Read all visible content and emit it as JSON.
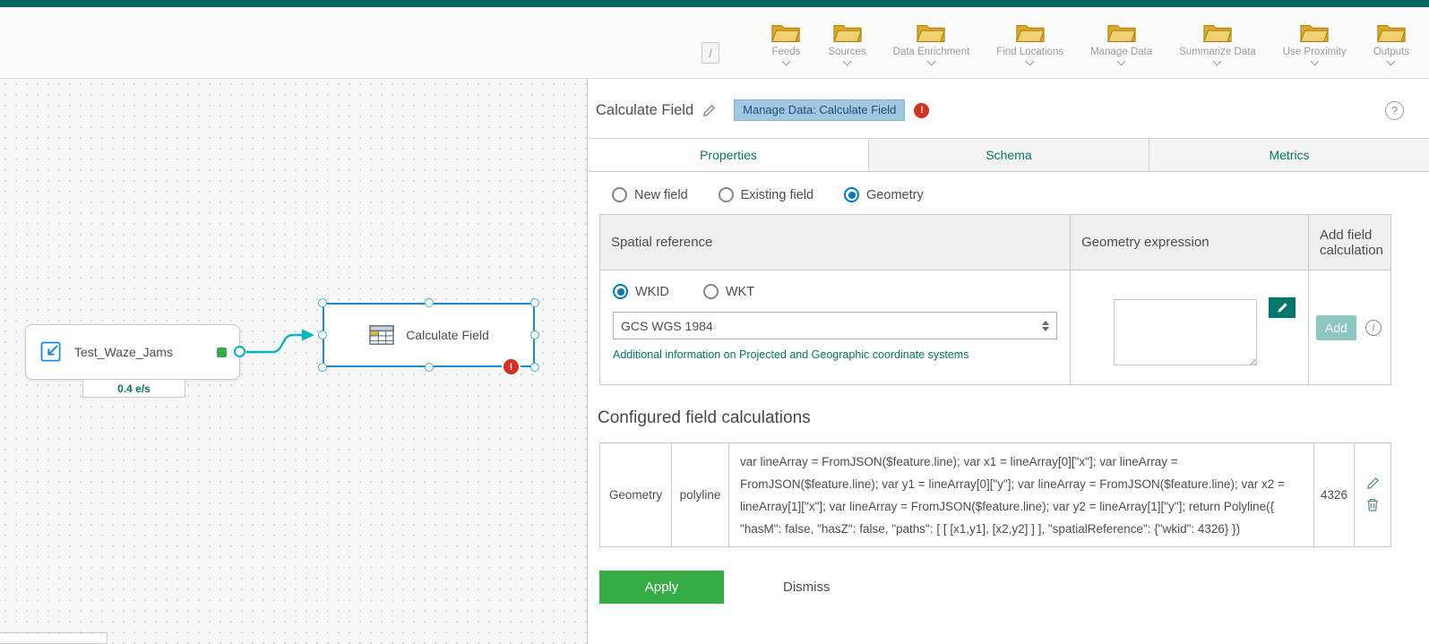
{
  "glyphs": {
    "slash": "/",
    "error": "!",
    "help": "?",
    "info": "i"
  },
  "colors": {
    "topbar": "#00665e",
    "accent_teal": "#00766c",
    "selection_blue": "#0079c1",
    "node_border_blue": "#1e88d2",
    "connection_teal": "#00b5bd",
    "error_red": "#d83020",
    "apply_green": "#35ac46",
    "badge_blue_bg": "#a2c7e0"
  },
  "toolbar": {
    "items": [
      {
        "label": "Feeds"
      },
      {
        "label": "Sources"
      },
      {
        "label": "Data Enrichment"
      },
      {
        "label": "Find Locations"
      },
      {
        "label": "Manage Data"
      },
      {
        "label": "Summarize Data"
      },
      {
        "label": "Use Proximity"
      },
      {
        "label": "Outputs"
      }
    ]
  },
  "canvas": {
    "source_node": {
      "label": "Test_Waze_Jams",
      "rate": "0.4 e/s"
    },
    "selected_node": {
      "label": "Calculate Field"
    }
  },
  "panel": {
    "title": "Calculate Field",
    "badge": "Manage Data: Calculate Field",
    "tabs": [
      {
        "label": "Properties",
        "active": true
      },
      {
        "label": "Schema",
        "active": false
      },
      {
        "label": "Metrics",
        "active": false
      }
    ],
    "field_type_options": [
      {
        "label": "New field",
        "selected": false
      },
      {
        "label": "Existing field",
        "selected": false
      },
      {
        "label": "Geometry",
        "selected": true
      }
    ],
    "geometry_config": {
      "headers": [
        "Spatial reference",
        "Geometry expression",
        "Add field calculation"
      ],
      "wkid_label": "WKID",
      "wkt_label": "WKT",
      "wkid_selected": true,
      "spatial_reference_value": "GCS WGS 1984",
      "info_link": "Additional information on Projected and Geographic coordinate systems",
      "add_button_label": "Add"
    },
    "configured": {
      "heading": "Configured field calculations",
      "rows": [
        {
          "field": "Geometry",
          "type": "polyline",
          "expression": "var lineArray = FromJSON($feature.line); var x1 = lineArray[0][\"x\"]; var lineArray = FromJSON($feature.line); var y1 = lineArray[0][\"y\"]; var lineArray = FromJSON($feature.line); var x2 = lineArray[1][\"x\"]; var lineArray = FromJSON($feature.line); var y2 = lineArray[1][\"y\"]; return Polyline({ \"hasM\": false, \"hasZ\": false, \"paths\": [ [ [x1,y1], [x2,y2] ] ], \"spatialReference\": {\"wkid\": 4326} })",
          "wkid": "4326"
        }
      ]
    },
    "footer": {
      "apply_label": "Apply",
      "dismiss_label": "Dismiss"
    }
  }
}
